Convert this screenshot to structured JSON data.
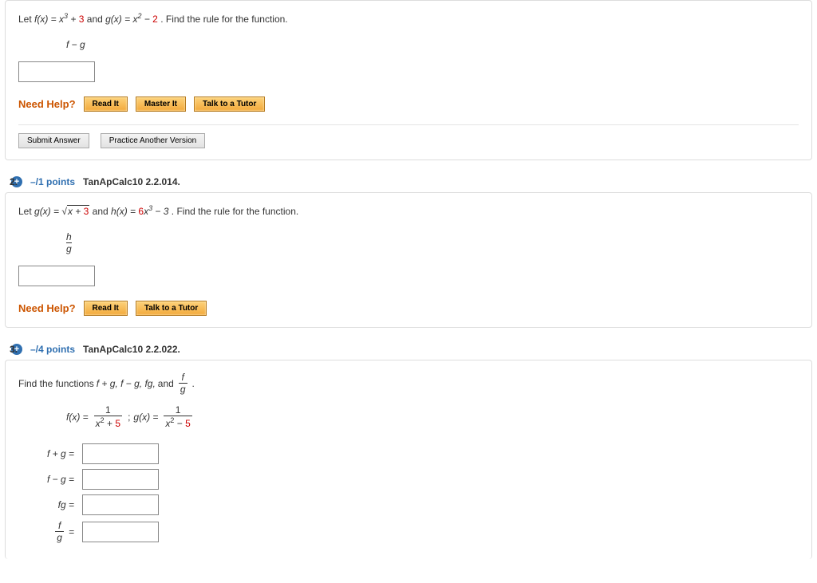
{
  "q1": {
    "text_pre": "Let ",
    "fx": "f(x) = x",
    "fx_sup": "3",
    "fx_post": " + ",
    "fx_const": "3",
    "and": " and ",
    "gx": "g(x) = x",
    "gx_sup": "2",
    "gx_post": " − ",
    "gx_const": "2",
    "tail": ". Find the rule for the function.",
    "frac_num": "f − g",
    "need_help": "Need Help?",
    "read_it": "Read It",
    "master_it": "Master It",
    "talk_tutor": "Talk to a Tutor",
    "submit": "Submit Answer",
    "practice": "Practice Another Version"
  },
  "q2": {
    "num": "2.",
    "points": "–/1 points",
    "ref": "TanApCalc10 2.2.014.",
    "text_pre": "Let ",
    "gx_pre": "g(x) = ",
    "sqrt_inner_a": "x + ",
    "sqrt_inner_b": "3",
    "and": " and ",
    "hx": "h(x) = ",
    "hx_coef": "6",
    "hx_var": "x",
    "hx_sup": "3",
    "hx_post": " − 3",
    "tail": ". Find the rule for the function.",
    "frac_num": "h",
    "frac_den": "g",
    "need_help": "Need Help?",
    "read_it": "Read It",
    "talk_tutor": "Talk to a Tutor"
  },
  "q3": {
    "num": "3.",
    "points": "–/4 points",
    "ref": "TanApCalc10 2.2.022.",
    "text_pre": "Find the functions ",
    "funcs": "f + g, f − g, fg,",
    "and": " and ",
    "frac_num": "f",
    "frac_den": "g",
    "period": ".",
    "fx_lhs": "f(x) = ",
    "fx_num": "1",
    "fx_den_a": "x",
    "fx_den_sup": "2",
    "fx_den_b": " + ",
    "fx_den_c": "5",
    "sep": "; ",
    "gx_lhs": "g(x) = ",
    "gx_num": "1",
    "gx_den_a": "x",
    "gx_den_sup": "2",
    "gx_den_b": " − ",
    "gx_den_c": "5",
    "l1": "f + g  =",
    "l2": "f − g  =",
    "l3": "fg  =",
    "l4_num": "f",
    "l4_den": "g",
    "l4_eq": "  ="
  }
}
